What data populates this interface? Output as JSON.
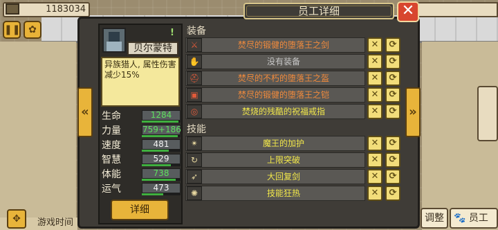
{
  "hud": {
    "gold": "1183034"
  },
  "title": "员工详细",
  "close_glyph": "✕",
  "character": {
    "name": "贝尔蒙特",
    "description": "异族猎人, 属性伤害减少15%",
    "stats": [
      {
        "label": "生命",
        "value": "1284",
        "highlight": true,
        "fill": 0.95
      },
      {
        "label": "力量",
        "value": "759+186",
        "highlight": true,
        "fill": 0.92
      },
      {
        "label": "速度",
        "value": "481",
        "highlight": false,
        "fill": 0.7
      },
      {
        "label": "智慧",
        "value": "529",
        "highlight": false,
        "fill": 0.75
      },
      {
        "label": "体能",
        "value": "738",
        "highlight": true,
        "fill": 0.88
      },
      {
        "label": "运气",
        "value": "473",
        "highlight": false,
        "fill": 0.55
      }
    ],
    "detail_button": "详细"
  },
  "equipment": {
    "header": "装备",
    "items": [
      {
        "name": "焚尽的锻健的堕落王之剑",
        "color": "orange",
        "icon": "sword-icon"
      },
      {
        "name": "没有装备",
        "color": "gray",
        "icon": "glove-icon"
      },
      {
        "name": "焚尽的不朽的堕落王之盔",
        "color": "orange",
        "icon": "helmet-icon"
      },
      {
        "name": "焚尽的锻健的堕落王之铠",
        "color": "orange",
        "icon": "armor-icon"
      },
      {
        "name": "焚烧的残酷的祝福戒指",
        "color": "yellow",
        "icon": "ring-icon"
      }
    ]
  },
  "skills": {
    "header": "技能",
    "items": [
      {
        "name": "魔王的加护",
        "icon": "aura-icon"
      },
      {
        "name": "上限突破",
        "icon": "break-icon"
      },
      {
        "name": "大回复剑",
        "icon": "heal-sword-icon"
      },
      {
        "name": "技能狂热",
        "icon": "frenzy-icon"
      }
    ]
  },
  "bottom": {
    "time_label": "游戏时间",
    "staff_label": "员工",
    "adjust_label": "调整"
  }
}
